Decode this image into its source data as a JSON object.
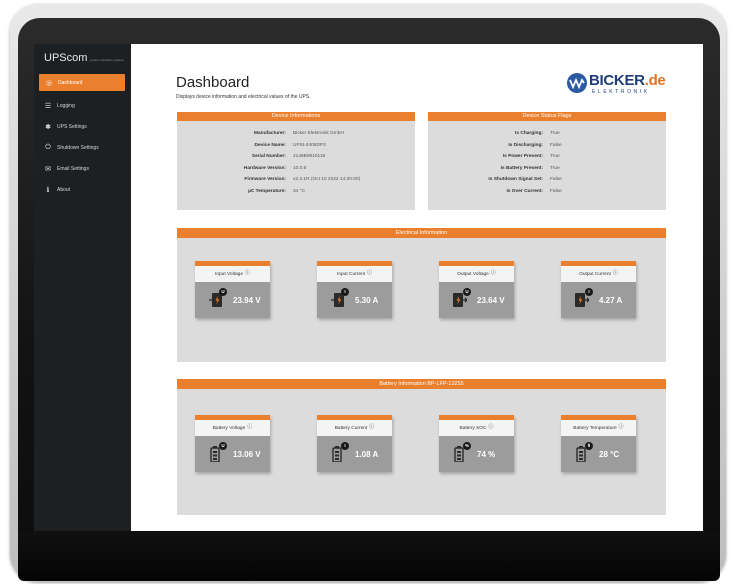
{
  "sidebar": {
    "brand": "UPScom",
    "brand_sub": "power solutions system",
    "items": [
      {
        "label": "Dashboard",
        "icon": "dashboard-icon",
        "active": true
      },
      {
        "label": "Logging",
        "icon": "list-icon",
        "active": false
      },
      {
        "label": "UPS Settings",
        "icon": "gear-icon",
        "active": false
      },
      {
        "label": "Shutdown Settings",
        "icon": "power-icon",
        "active": false
      },
      {
        "label": "Email Settings",
        "icon": "envelope-icon",
        "active": false
      },
      {
        "label": "About",
        "icon": "info-icon",
        "active": false
      }
    ]
  },
  "header": {
    "title": "Dashboard",
    "subtitle": "Displays device information and electrical values of the UPS.",
    "logo": {
      "word": "BICKER",
      "tld": ".de",
      "tagline": "ELEKTRONIK"
    }
  },
  "device_info": {
    "title": "Device Informations",
    "rows": [
      {
        "label": "Manufacturer:",
        "value": "Bicker Elektronik GmbH"
      },
      {
        "label": "Device Name:",
        "value": "UPSI-2406DP3"
      },
      {
        "label": "Serial Number:",
        "value": "2146B0610118"
      },
      {
        "label": "Hardware Version:",
        "value": "10.0.6"
      },
      {
        "label": "Firmware Version:",
        "value": "v2.3.1R (Oct 10 2022 14:20:00)"
      },
      {
        "label": "µC Temperature:",
        "value": "34 °C"
      }
    ]
  },
  "status_flags": {
    "title": "Device Status Flags",
    "rows": [
      {
        "label": "Is Charging:",
        "value": "True"
      },
      {
        "label": "Is Discharging:",
        "value": "False"
      },
      {
        "label": "Is Power Present:",
        "value": "True"
      },
      {
        "label": "Is Battery Present:",
        "value": "True"
      },
      {
        "label": "Is Shutdown Signal Set:",
        "value": "False"
      },
      {
        "label": "Is Over Current:",
        "value": "False"
      }
    ]
  },
  "electrical": {
    "title": "Electrical Information",
    "cards": [
      {
        "label": "Input Voltage",
        "value": "23.94 V",
        "icon": "input-voltage-icon",
        "badge": "U"
      },
      {
        "label": "Input Current",
        "value": "5.30 A",
        "icon": "input-current-icon",
        "badge": "I"
      },
      {
        "label": "Output Voltage",
        "value": "23.64 V",
        "icon": "output-voltage-icon",
        "badge": "U"
      },
      {
        "label": "Output Current",
        "value": "4.27 A",
        "icon": "output-current-icon",
        "badge": "I"
      }
    ]
  },
  "battery": {
    "title": "Battery Information BP-LFP-13255",
    "cards": [
      {
        "label": "Battery Voltage",
        "value": "13.06 V",
        "icon": "battery-voltage-icon",
        "badge": "U"
      },
      {
        "label": "Battery Current",
        "value": "1.08 A",
        "icon": "battery-current-icon",
        "badge": "I"
      },
      {
        "label": "Battery SOC",
        "value": "74 %",
        "icon": "battery-soc-icon",
        "badge": "%"
      },
      {
        "label": "Battery Temperature",
        "value": "28 °C",
        "icon": "battery-temperature-icon",
        "badge": "θ"
      }
    ]
  },
  "help_glyph": "ⓘ",
  "colors": {
    "accent": "#ea7f2d",
    "sidebar": "#1d2023",
    "panel": "#dcdcdc",
    "card_body": "#9c9c9c"
  }
}
